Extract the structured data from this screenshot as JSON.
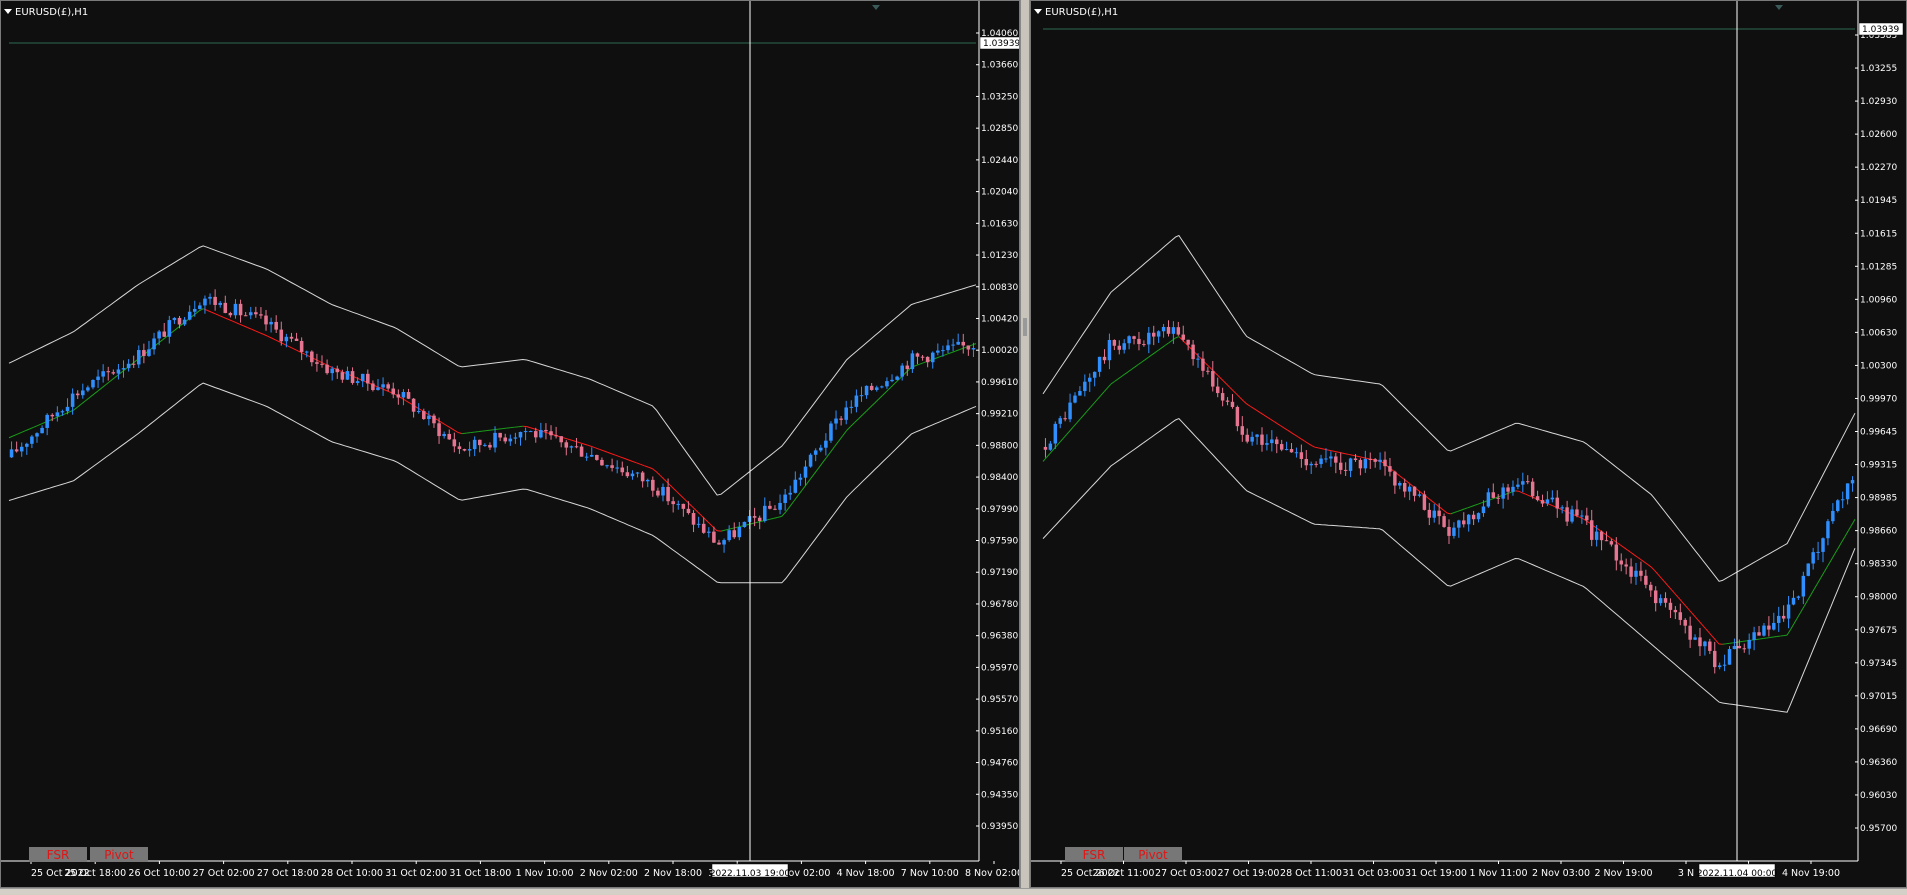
{
  "colors": {
    "background": "#0f0f0f",
    "axis_text": "#ffffff",
    "bull_candle": "#2f8fff",
    "bear_candle": "#e57590",
    "envelope_band": "#d8d8d8",
    "ma_falling": "#ff1a1a",
    "ma_rising": "#1a9e1a",
    "crosshair": "#ffffff",
    "button_bg": "#777777",
    "button_text": "#e01515",
    "bid_line": "#2e6b52"
  },
  "charts": [
    {
      "title": "EURUSD(£),H1",
      "bid_label": "1.03939",
      "price_ticks": [
        "1.04060",
        "1.03660",
        "1.03250",
        "1.02850",
        "1.02440",
        "1.02040",
        "1.01630",
        "1.01230",
        "1.00830",
        "1.00420",
        "1.00020",
        "0.99610",
        "0.99210",
        "0.98800",
        "0.98400",
        "0.97990",
        "0.97590",
        "0.97190",
        "0.96780",
        "0.96380",
        "0.95970",
        "0.95570",
        "0.95160",
        "0.94760",
        "0.94350",
        "0.93950"
      ],
      "time_ticks": [
        "25 Oct 2022",
        "25 Oct 18:00",
        "26 Oct 10:00",
        "27 Oct 02:00",
        "27 Oct 18:00",
        "28 Oct 10:00",
        "31 Oct 02:00",
        "31 Oct 18:00",
        "1 Nov 10:00",
        "2 Nov 02:00",
        "2 Nov 18:00",
        "3 Nov 10:00",
        "4 Nov 02:00",
        "4 Nov 18:00",
        "7 Nov 10:00",
        "8 Nov 02:00"
      ],
      "crosshair_time": "2022.11.03 19:00",
      "buttons": [
        "FSR",
        "Pivot"
      ],
      "icons": [
        "dropdown-triangle-icon",
        "scroll-marker-icon"
      ],
      "chart_data": {
        "type": "line",
        "symbol": "EURUSD(£)",
        "timeframe": "H1",
        "ylim": [
          0.9395,
          1.0406
        ],
        "bid": 1.03939,
        "x": [
          "25 Oct 2022",
          "25 Oct 18:00",
          "26 Oct 10:00",
          "27 Oct 02:00",
          "27 Oct 18:00",
          "28 Oct 10:00",
          "31 Oct 02:00",
          "31 Oct 18:00",
          "1 Nov 10:00",
          "2 Nov 02:00",
          "2 Nov 18:00",
          "3 Nov 10:00",
          "4 Nov 02:00",
          "4 Nov 18:00",
          "7 Nov 10:00",
          "8 Nov 02:00"
        ],
        "series": [
          {
            "values": [
              0.9865,
              0.9945,
              0.9995,
              1.007,
              1.0035,
              0.9975,
              0.995,
              0.9875,
              0.99,
              0.987,
              0.983,
              0.9755,
              0.981,
              0.993,
              0.999,
              1.001
            ]
          },
          {
            "values": [
              0.989,
              0.9925,
              0.999,
              1.0055,
              1.002,
              0.998,
              0.9945,
              0.9895,
              0.9905,
              0.988,
              0.985,
              0.977,
              0.979,
              0.99,
              0.998,
              1.001
            ]
          },
          {
            "values": [
              0.9985,
              1.0025,
              1.0085,
              1.0135,
              1.0105,
              1.006,
              1.003,
              0.998,
              0.999,
              0.9965,
              0.993,
              0.9815,
              0.988,
              0.999,
              1.006,
              1.0085
            ]
          },
          {
            "values": [
              0.981,
              0.9835,
              0.9895,
              0.996,
              0.993,
              0.9885,
              0.986,
              0.981,
              0.9825,
              0.98,
              0.9765,
              0.9705,
              0.9705,
              0.9815,
              0.9895,
              0.993
            ]
          }
        ]
      }
    },
    {
      "title": "EURUSD(£),H1",
      "bid_label": "1.03939",
      "price_ticks": [
        "1.03585",
        "1.03255",
        "1.02930",
        "1.02600",
        "1.02270",
        "1.01945",
        "1.01615",
        "1.01285",
        "1.00960",
        "1.00630",
        "1.00300",
        "0.99970",
        "0.99645",
        "0.99315",
        "0.98985",
        "0.98660",
        "0.98330",
        "0.98000",
        "0.97675",
        "0.97345",
        "0.97015",
        "0.96690",
        "0.96360",
        "0.96030",
        "0.95700"
      ],
      "time_ticks": [
        "25 Oct 2022",
        "26 Oct 11:00",
        "27 Oct 03:00",
        "27 Oct 19:00",
        "28 Oct 11:00",
        "31 Oct 03:00",
        "31 Oct 19:00",
        "1 Nov 11:00",
        "2 Nov 03:00",
        "2 Nov 19:00",
        "3 N",
        "03:00",
        "4 Nov 19:00"
      ],
      "crosshair_time": "2022.11.04 00:00",
      "buttons": [
        "FSR",
        "Pivot"
      ],
      "icons": [
        "dropdown-triangle-icon",
        "scroll-marker-icon"
      ],
      "chart_data": {
        "type": "line",
        "symbol": "EURUSD(£)",
        "timeframe": "H1",
        "ylim": [
          0.957,
          1.0392
        ],
        "bid": 1.03939,
        "x": [
          "25 Oct 2022",
          "26 Oct 11:00",
          "27 Oct 03:00",
          "27 Oct 19:00",
          "28 Oct 11:00",
          "31 Oct 03:00",
          "31 Oct 19:00",
          "1 Nov 11:00",
          "2 Nov 03:00",
          "2 Nov 19:00",
          "3 N",
          "03:00",
          "4 Nov 19:00"
        ],
        "series": [
          {
            "values": [
              0.9965,
              1.007,
              1.0085,
              0.998,
              0.995,
              0.9945,
              0.988,
              0.993,
              0.9885,
              0.9815,
              0.974,
              0.979,
              0.994
            ]
          },
          {
            "values": [
              0.995,
              1.003,
              1.008,
              1.001,
              0.9965,
              0.995,
              0.9895,
              0.992,
              0.989,
              0.984,
              0.976,
              0.977,
              0.989
            ]
          },
          {
            "values": [
              1.002,
              1.0125,
              1.0185,
              1.008,
              1.004,
              1.003,
              0.996,
              0.999,
              0.997,
              0.9915,
              0.9825,
              0.9865,
              1.0
            ]
          },
          {
            "values": [
              0.987,
              0.9945,
              0.9995,
              0.992,
              0.9885,
              0.988,
              0.982,
              0.985,
              0.982,
              0.976,
              0.97,
              0.969,
              0.986
            ]
          }
        ]
      }
    }
  ]
}
